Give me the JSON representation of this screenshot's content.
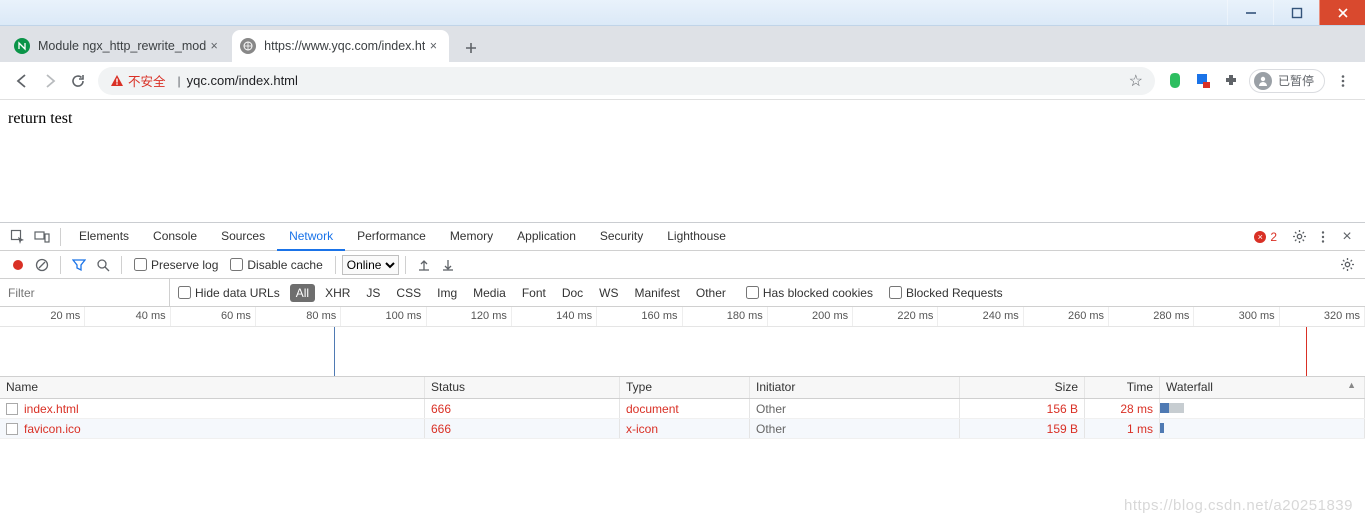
{
  "window": {
    "minimize": "–",
    "maximize": "❐",
    "close": "×"
  },
  "tabs": [
    {
      "title": "Module ngx_http_rewrite_mod",
      "fav": "nginx",
      "active": false
    },
    {
      "title": "https://www.yqc.com/index.ht",
      "fav": "generic",
      "active": true
    }
  ],
  "addressbar": {
    "nav": {
      "back": "back",
      "forward": "forward",
      "reload": "reload"
    },
    "warn_label": "不安全",
    "url": "yqc.com/index.html",
    "star": "bookmark",
    "profile_label": "已暂停"
  },
  "page": {
    "body_text": "return test"
  },
  "devtools": {
    "panels": [
      "Elements",
      "Console",
      "Sources",
      "Network",
      "Performance",
      "Memory",
      "Application",
      "Security",
      "Lighthouse"
    ],
    "active_panel": "Network",
    "error_count": "2",
    "net_toolbar": {
      "preserve_log": "Preserve log",
      "disable_cache": "Disable cache",
      "throttle": "Online"
    },
    "filter_row": {
      "placeholder": "Filter",
      "hide_data_urls": "Hide data URLs",
      "types": [
        "All",
        "XHR",
        "JS",
        "CSS",
        "Img",
        "Media",
        "Font",
        "Doc",
        "WS",
        "Manifest",
        "Other"
      ],
      "active_type": "All",
      "has_blocked_cookies": "Has blocked cookies",
      "blocked_requests": "Blocked Requests"
    },
    "overview_ticks": [
      "20 ms",
      "40 ms",
      "60 ms",
      "80 ms",
      "100 ms",
      "120 ms",
      "140 ms",
      "160 ms",
      "180 ms",
      "200 ms",
      "220 ms",
      "240 ms",
      "260 ms",
      "280 ms",
      "300 ms",
      "320 ms"
    ],
    "overview_markers": [
      {
        "pos_pct": 24.5,
        "color": "#4f7ab3"
      },
      {
        "pos_pct": 95.7,
        "color": "#d93025"
      }
    ],
    "table": {
      "headers": {
        "name": "Name",
        "status": "Status",
        "type": "Type",
        "initiator": "Initiator",
        "size": "Size",
        "time": "Time",
        "waterfall": "Waterfall"
      },
      "rows": [
        {
          "name": "index.html",
          "status": "666",
          "type": "document",
          "initiator": "Other",
          "size": "156 B",
          "time": "28 ms",
          "wf_left": 0,
          "wf_width": 12,
          "wf_fg": 35
        },
        {
          "name": "favicon.ico",
          "status": "666",
          "type": "x-icon",
          "initiator": "Other",
          "size": "159 B",
          "time": "1 ms",
          "wf_left": 0,
          "wf_width": 2,
          "wf_fg": 100
        }
      ]
    }
  },
  "watermark": "https://blog.csdn.net/a20251839"
}
